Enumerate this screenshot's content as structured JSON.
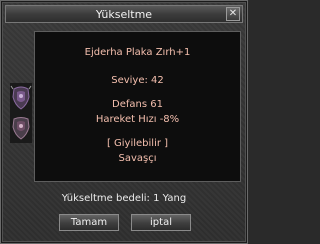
{
  "window": {
    "title": "Yükseltme",
    "close_label": "✕"
  },
  "item": {
    "name": "Ejderha Plaka Zırh+1",
    "level": "Seviye: 42",
    "defense": "Defans 61",
    "speed": "Hareket Hızı -8%",
    "wearable": "[ Giyilebilir ]",
    "class": "Savaşçı"
  },
  "cost": "Yükseltme bedeli: 1 Yang",
  "buttons": {
    "ok": "Tamam",
    "cancel": "iptal"
  },
  "colors": {
    "item_text": "#f4bfae",
    "panel_bg": "#0d0d0d"
  }
}
